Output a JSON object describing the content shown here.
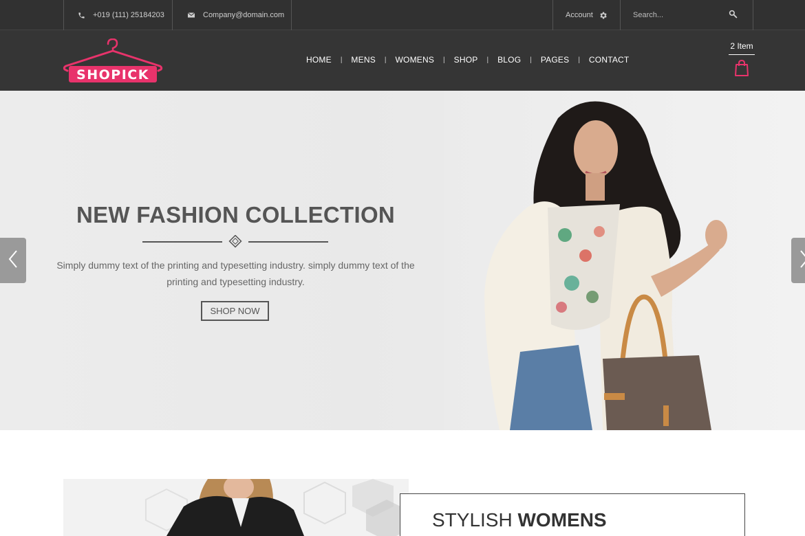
{
  "topbar": {
    "phone": "+019 (111) 25184203",
    "email": "Company@domain.com",
    "account_label": "Account",
    "search_placeholder": "Search..."
  },
  "header": {
    "logo_text": "SHOPICK",
    "nav": [
      "HOME",
      "MENS",
      "WOMENS",
      "SHOP",
      "BLOG",
      "PAGES",
      "CONTACT"
    ],
    "nav_separator": "|",
    "cart_label": "2 Item"
  },
  "hero": {
    "title": "NEW FASHION COLLECTION",
    "text_line1": "Simply dummy text of the printing and typesetting industry. simply dummy text of the",
    "text_line2": "printing and typesetting industry.",
    "button_label": "SHOP NOW"
  },
  "promo": {
    "title_light": "STYLISH",
    "title_bold": "WOMENS"
  },
  "colors": {
    "accent_pink": "#e8336b",
    "header_bg": "#353535",
    "topbar_bg": "#313131"
  },
  "icons": [
    "phone-icon",
    "mail-icon",
    "gear-icon",
    "search-icon",
    "shopping-bag-icon",
    "chevron-left-icon",
    "chevron-right-icon",
    "diamond-icon",
    "hanger-icon"
  ]
}
